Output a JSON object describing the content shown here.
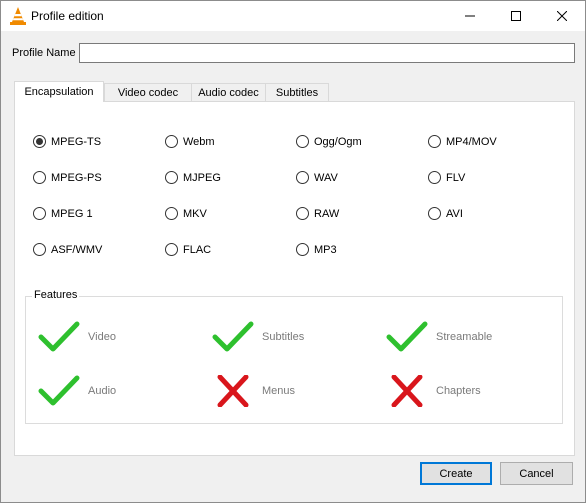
{
  "window": {
    "title": "Profile edition",
    "controls": {
      "minimize_icon": "minimize-icon",
      "maximize_icon": "maximize-icon",
      "close_icon": "close-icon"
    }
  },
  "profile": {
    "label": "Profile Name",
    "value": "",
    "placeholder": ""
  },
  "tabs": [
    {
      "label": "Encapsulation",
      "active": true
    },
    {
      "label": "Video codec",
      "active": false
    },
    {
      "label": "Audio codec",
      "active": false
    },
    {
      "label": "Subtitles",
      "active": false
    }
  ],
  "encapsulation": {
    "options": [
      {
        "label": "MPEG-TS",
        "checked": true
      },
      {
        "label": "Webm",
        "checked": false
      },
      {
        "label": "Ogg/Ogm",
        "checked": false
      },
      {
        "label": "MP4/MOV",
        "checked": false
      },
      {
        "label": "MPEG-PS",
        "checked": false
      },
      {
        "label": "MJPEG",
        "checked": false
      },
      {
        "label": "WAV",
        "checked": false
      },
      {
        "label": "FLV",
        "checked": false
      },
      {
        "label": "MPEG 1",
        "checked": false
      },
      {
        "label": "MKV",
        "checked": false
      },
      {
        "label": "RAW",
        "checked": false
      },
      {
        "label": "AVI",
        "checked": false
      },
      {
        "label": "ASF/WMV",
        "checked": false
      },
      {
        "label": "FLAC",
        "checked": false
      },
      {
        "label": "MP3",
        "checked": false
      }
    ]
  },
  "features": {
    "legend": "Features",
    "items": [
      {
        "label": "Video",
        "supported": true
      },
      {
        "label": "Subtitles",
        "supported": true
      },
      {
        "label": "Streamable",
        "supported": true
      },
      {
        "label": "Audio",
        "supported": true
      },
      {
        "label": "Menus",
        "supported": false
      },
      {
        "label": "Chapters",
        "supported": false
      }
    ],
    "colors": {
      "supported": "#2ec02e",
      "unsupported": "#d9161c"
    }
  },
  "buttons": {
    "create": "Create",
    "cancel": "Cancel"
  }
}
